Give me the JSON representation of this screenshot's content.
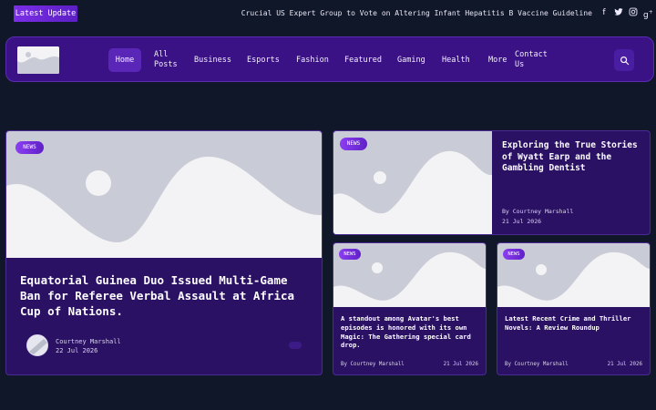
{
  "top_bar": {
    "latest_label": "Latest Update",
    "ticker": "Crucial US Expert Group to Vote on Altering Infant Hepatitis B Vaccine Guideline",
    "social_icons": [
      "facebook-icon",
      "twitter-icon",
      "instagram-icon",
      "google-plus-icon"
    ]
  },
  "nav": {
    "items": [
      {
        "label": "Home",
        "active": true
      },
      {
        "label": "All Posts"
      },
      {
        "label": "Business"
      },
      {
        "label": "Esports"
      },
      {
        "label": "Fashion"
      },
      {
        "label": "Featured"
      },
      {
        "label": "Gaming"
      },
      {
        "label": "Health"
      },
      {
        "label": "More"
      },
      {
        "label": "Contact Us"
      }
    ],
    "search_icon": "search-icon"
  },
  "posts": {
    "main": {
      "badge": "NEWS",
      "title": "Equatorial Guinea Duo Issued Multi-Game Ban for Referee Verbal Assault at Africa Cup of Nations.",
      "author": "Courtney Marshall",
      "date": "22 Jul 2026"
    },
    "top_right": {
      "badge": "NEWS",
      "title": "Exploring the True Stories of Wyatt Earp and the Gambling Dentist",
      "author": "By Courtney Marshall",
      "date": "21 Jul 2026"
    },
    "bottom_left": {
      "badge": "NEWS",
      "title": "A standout among Avatar's best episodes is honored with its own Magic: The Gathering special card drop.",
      "author": "By Courtney Marshall",
      "date": "21 Jul 2026"
    },
    "bottom_right": {
      "badge": "NEWS",
      "title": "Latest Recent Crime and Thriller Novels: A Review Roundup",
      "author": "By Courtney Marshall",
      "date": "21 Jul 2026"
    }
  },
  "colors": {
    "background": "#0f1729",
    "nav": "#3b1286",
    "card": "#2a1164",
    "accent": "#7b2ee6"
  }
}
